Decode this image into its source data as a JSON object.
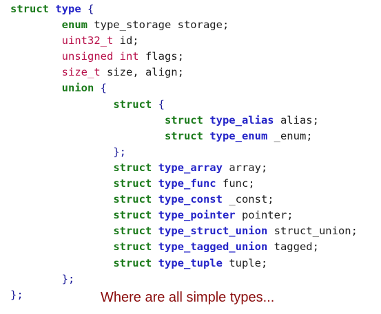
{
  "colors": {
    "background": "#ffffff",
    "plain": "#1e1e1e",
    "keyword": "#1a7a1a",
    "type": "#2424c8",
    "builtin": "#b8104a",
    "punct": "#1a1a99",
    "caption": "#8b0d0d"
  },
  "code_lines": [
    [
      {
        "t": "struct",
        "c": "keyword"
      },
      {
        "t": " ",
        "c": "plain"
      },
      {
        "t": "type",
        "c": "type"
      },
      {
        "t": " {",
        "c": "punct"
      }
    ],
    [
      {
        "t": "        ",
        "c": "plain"
      },
      {
        "t": "enum",
        "c": "keyword"
      },
      {
        "t": " type_storage storage;",
        "c": "plain"
      }
    ],
    [
      {
        "t": "        ",
        "c": "plain"
      },
      {
        "t": "uint32_t",
        "c": "builtin"
      },
      {
        "t": " id;",
        "c": "plain"
      }
    ],
    [
      {
        "t": "        ",
        "c": "plain"
      },
      {
        "t": "unsigned int",
        "c": "builtin"
      },
      {
        "t": " flags;",
        "c": "plain"
      }
    ],
    [
      {
        "t": "        ",
        "c": "plain"
      },
      {
        "t": "size_t",
        "c": "builtin"
      },
      {
        "t": " size, align;",
        "c": "plain"
      }
    ],
    [
      {
        "t": "        ",
        "c": "plain"
      },
      {
        "t": "union",
        "c": "keyword"
      },
      {
        "t": " {",
        "c": "punct"
      }
    ],
    [
      {
        "t": "                ",
        "c": "plain"
      },
      {
        "t": "struct",
        "c": "keyword"
      },
      {
        "t": " {",
        "c": "punct"
      }
    ],
    [
      {
        "t": "                        ",
        "c": "plain"
      },
      {
        "t": "struct",
        "c": "keyword"
      },
      {
        "t": " ",
        "c": "plain"
      },
      {
        "t": "type_alias",
        "c": "type"
      },
      {
        "t": " alias;",
        "c": "plain"
      }
    ],
    [
      {
        "t": "                        ",
        "c": "plain"
      },
      {
        "t": "struct",
        "c": "keyword"
      },
      {
        "t": " ",
        "c": "plain"
      },
      {
        "t": "type_enum",
        "c": "type"
      },
      {
        "t": " _enum;",
        "c": "plain"
      }
    ],
    [
      {
        "t": "                ",
        "c": "plain"
      },
      {
        "t": "};",
        "c": "punct"
      }
    ],
    [
      {
        "t": "                ",
        "c": "plain"
      },
      {
        "t": "struct",
        "c": "keyword"
      },
      {
        "t": " ",
        "c": "plain"
      },
      {
        "t": "type_array",
        "c": "type"
      },
      {
        "t": " array;",
        "c": "plain"
      }
    ],
    [
      {
        "t": "                ",
        "c": "plain"
      },
      {
        "t": "struct",
        "c": "keyword"
      },
      {
        "t": " ",
        "c": "plain"
      },
      {
        "t": "type_func",
        "c": "type"
      },
      {
        "t": " func;",
        "c": "plain"
      }
    ],
    [
      {
        "t": "                ",
        "c": "plain"
      },
      {
        "t": "struct",
        "c": "keyword"
      },
      {
        "t": " ",
        "c": "plain"
      },
      {
        "t": "type_const",
        "c": "type"
      },
      {
        "t": " _const;",
        "c": "plain"
      }
    ],
    [
      {
        "t": "                ",
        "c": "plain"
      },
      {
        "t": "struct",
        "c": "keyword"
      },
      {
        "t": " ",
        "c": "plain"
      },
      {
        "t": "type_pointer",
        "c": "type"
      },
      {
        "t": " pointer;",
        "c": "plain"
      }
    ],
    [
      {
        "t": "                ",
        "c": "plain"
      },
      {
        "t": "struct",
        "c": "keyword"
      },
      {
        "t": " ",
        "c": "plain"
      },
      {
        "t": "type_struct_union",
        "c": "type"
      },
      {
        "t": " struct_union;",
        "c": "plain"
      }
    ],
    [
      {
        "t": "                ",
        "c": "plain"
      },
      {
        "t": "struct",
        "c": "keyword"
      },
      {
        "t": " ",
        "c": "plain"
      },
      {
        "t": "type_tagged_union",
        "c": "type"
      },
      {
        "t": " tagged;",
        "c": "plain"
      }
    ],
    [
      {
        "t": "                ",
        "c": "plain"
      },
      {
        "t": "struct",
        "c": "keyword"
      },
      {
        "t": " ",
        "c": "plain"
      },
      {
        "t": "type_tuple",
        "c": "type"
      },
      {
        "t": " tuple;",
        "c": "plain"
      }
    ],
    [
      {
        "t": "        ",
        "c": "plain"
      },
      {
        "t": "};",
        "c": "punct"
      }
    ],
    [
      {
        "t": "};",
        "c": "punct"
      }
    ]
  ],
  "caption": "Where are all simple types..."
}
